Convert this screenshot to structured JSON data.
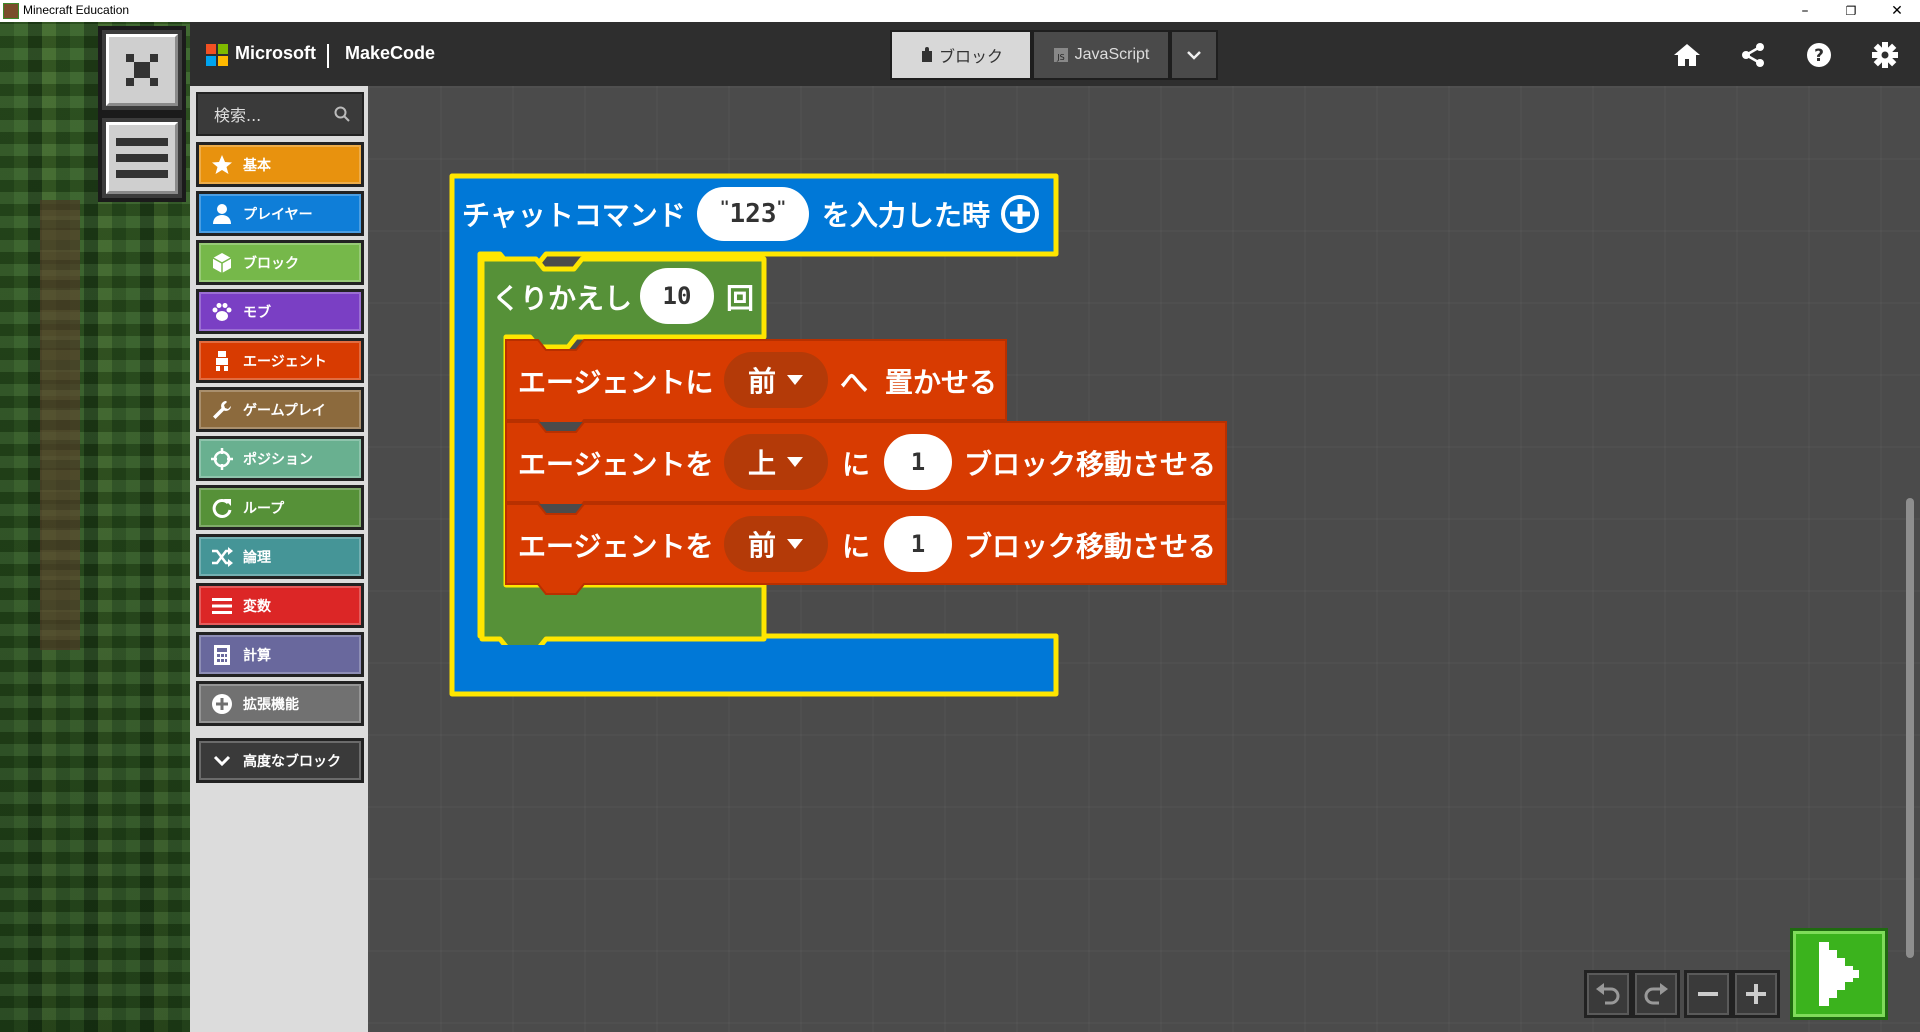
{
  "window": {
    "title": "Minecraft Education",
    "minimize": "–",
    "restore": "❐",
    "close": "✕"
  },
  "header": {
    "brand": "Microsoft",
    "product": "MakeCode",
    "toggle_blocks": "ブロック",
    "toggle_js": "JavaScript"
  },
  "toolbox": {
    "search_placeholder": "検索...",
    "categories": [
      {
        "label": "基本",
        "color": "#e8920e",
        "icon": "star-icon"
      },
      {
        "label": "プレイヤー",
        "color": "#0f7ed8",
        "icon": "player-icon"
      },
      {
        "label": "ブロック",
        "color": "#76b84a",
        "icon": "cube-icon"
      },
      {
        "label": "モブ",
        "color": "#7a3fc4",
        "icon": "paw-icon"
      },
      {
        "label": "エージェント",
        "color": "#d83b01",
        "icon": "agent-icon"
      },
      {
        "label": "ゲームプレイ",
        "color": "#8c6a3d",
        "icon": "wrench-icon"
      },
      {
        "label": "ポジション",
        "color": "#69b090",
        "icon": "crosshair-icon"
      },
      {
        "label": "ループ",
        "color": "#569138",
        "icon": "loop-icon"
      },
      {
        "label": "論理",
        "color": "#459597",
        "icon": "shuffle-icon"
      },
      {
        "label": "変数",
        "color": "#dc2626",
        "icon": "list-icon"
      },
      {
        "label": "計算",
        "color": "#69689d",
        "icon": "calculator-icon"
      },
      {
        "label": "拡張機能",
        "color": "#717171",
        "icon": "plus-circle-icon"
      }
    ],
    "advanced": "高度なブロック"
  },
  "blocks": {
    "event": {
      "prefix": "チャットコマンド",
      "command": "123",
      "suffix": "を入力した時",
      "color": "#0078d7"
    },
    "repeat": {
      "prefix": "くりかえし",
      "count": "10",
      "suffix": "回",
      "color": "#569138"
    },
    "place": {
      "prefix": "エージェントに",
      "dir": "前",
      "mid": "へ",
      "suffix": "置かせる",
      "color": "#d83b01"
    },
    "move1": {
      "prefix": "エージェントを",
      "dir": "上",
      "mid": "に",
      "amount": "1",
      "suffix": "ブロック移動させる"
    },
    "move2": {
      "prefix": "エージェントを",
      "dir": "前",
      "mid": "に",
      "amount": "1",
      "suffix": "ブロック移動させる"
    }
  }
}
